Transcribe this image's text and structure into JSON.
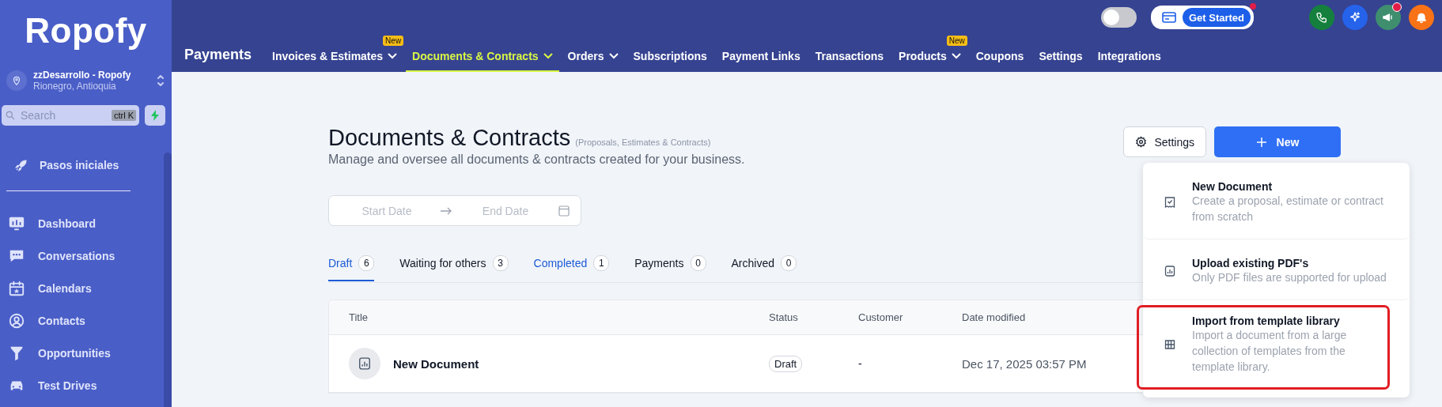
{
  "sidebar": {
    "logo": "Ropofy",
    "account": {
      "name": "zzDesarrollo - Ropofy",
      "location": "Rionegro, Antioquia"
    },
    "search": {
      "placeholder": "Search",
      "shortcut": "ctrl K"
    },
    "pinned": [
      {
        "label": "Pasos iniciales"
      }
    ],
    "items": [
      {
        "label": "Dashboard"
      },
      {
        "label": "Conversations"
      },
      {
        "label": "Calendars"
      },
      {
        "label": "Contacts"
      },
      {
        "label": "Opportunities"
      },
      {
        "label": "Test Drives"
      }
    ]
  },
  "topbar": {
    "toggle": {
      "on": false
    },
    "get_started": {
      "label": "Get Started",
      "notification": true
    },
    "icon_buttons": [
      {
        "color": "#15803d",
        "notification": false
      },
      {
        "color": "#2563eb",
        "notification": false
      },
      {
        "color": "#3f8f6f",
        "notification": true
      },
      {
        "color": "#f97316",
        "notification": false
      }
    ]
  },
  "nav": {
    "title": "Payments",
    "items": [
      {
        "label": "Invoices & Estimates",
        "dropdown": true,
        "badge": "New",
        "selected": false
      },
      {
        "label": "Documents & Contracts",
        "dropdown": true,
        "selected": true
      },
      {
        "label": "Orders",
        "dropdown": true,
        "selected": false
      },
      {
        "label": "Subscriptions",
        "dropdown": false,
        "selected": false
      },
      {
        "label": "Payment Links",
        "dropdown": false,
        "selected": false
      },
      {
        "label": "Transactions",
        "dropdown": false,
        "selected": false
      },
      {
        "label": "Products",
        "dropdown": true,
        "badge": "New",
        "selected": false
      },
      {
        "label": "Coupons",
        "dropdown": false,
        "selected": false
      },
      {
        "label": "Settings",
        "dropdown": false,
        "selected": false
      },
      {
        "label": "Integrations",
        "dropdown": false,
        "selected": false
      }
    ]
  },
  "page": {
    "title": "Documents & Contracts",
    "title_note": "(Proposals, Estimates & Contracts)",
    "description": "Manage and oversee all documents & contracts created for your business.",
    "date_range": {
      "start_placeholder": "Start Date",
      "end_placeholder": "End Date"
    },
    "settings_button": "Settings",
    "new_button": "New",
    "tabs": [
      {
        "label": "Draft",
        "count": "6",
        "selected": true,
        "accent": true
      },
      {
        "label": "Waiting for others",
        "count": "3",
        "selected": false,
        "accent": false
      },
      {
        "label": "Completed",
        "count": "1",
        "selected": false,
        "accent": true
      },
      {
        "label": "Payments",
        "count": "0",
        "selected": false,
        "accent": false
      },
      {
        "label": "Archived",
        "count": "0",
        "selected": false,
        "accent": false
      }
    ],
    "table": {
      "columns": [
        "Title",
        "Status",
        "Customer",
        "Date modified"
      ],
      "rows": [
        {
          "title": "New Document",
          "status": "Draft",
          "customer": "-",
          "date_modified": "Dec 17, 2025 03:57 PM"
        }
      ]
    },
    "new_menu": [
      {
        "title": "New Document",
        "description": "Create a proposal, estimate or contract from scratch",
        "highlighted": false
      },
      {
        "title": "Upload existing PDF's",
        "description": "Only PDF files are supported for upload",
        "highlighted": false
      },
      {
        "title": "Import from template library",
        "description": "Import a document from a large collection of templates from the template library.",
        "highlighted": true
      }
    ]
  }
}
